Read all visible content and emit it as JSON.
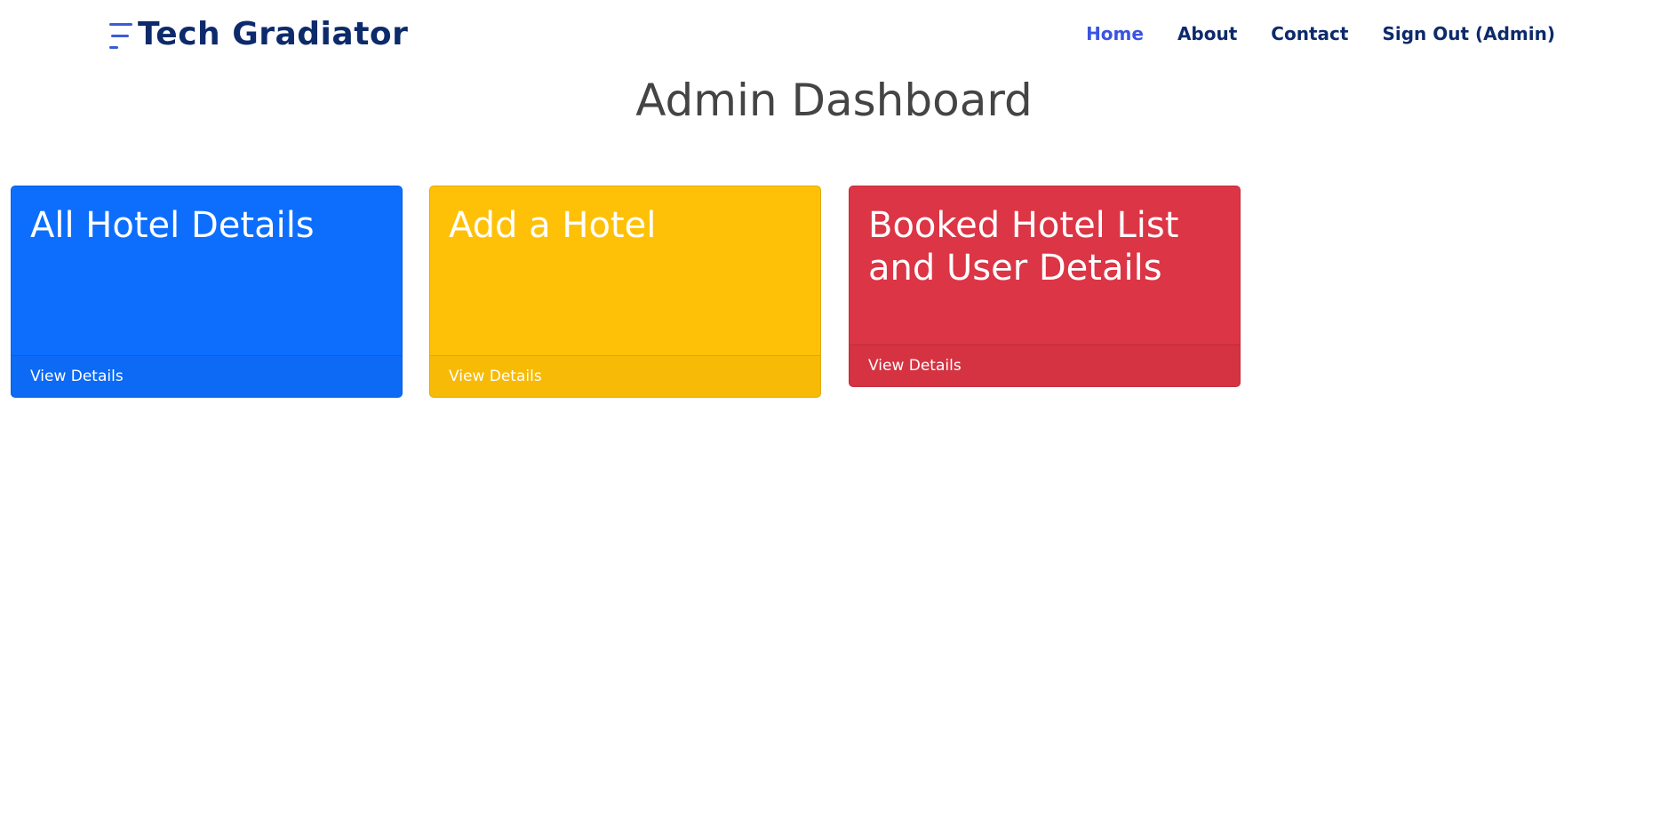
{
  "brand": {
    "name": "Tech Gradiator",
    "mark_icon": "three-lines-logo-icon",
    "color": "#0d2a6b",
    "mark_color": "#3a5bd9"
  },
  "nav": {
    "active_color": "#3b54e0",
    "items": [
      {
        "label": "Home",
        "active": true
      },
      {
        "label": "About",
        "active": false
      },
      {
        "label": "Contact",
        "active": false
      },
      {
        "label": "Sign Out (Admin)",
        "active": false
      }
    ]
  },
  "page": {
    "title": "Admin Dashboard"
  },
  "cards": [
    {
      "title": "All Hotel Details",
      "link": "View Details",
      "color": "#0d6efd"
    },
    {
      "title": "Add a Hotel",
      "link": "View Details",
      "color": "#ffc107"
    },
    {
      "title": "Booked Hotel List and User Details",
      "link": "View Details",
      "color": "#dc3545"
    }
  ]
}
